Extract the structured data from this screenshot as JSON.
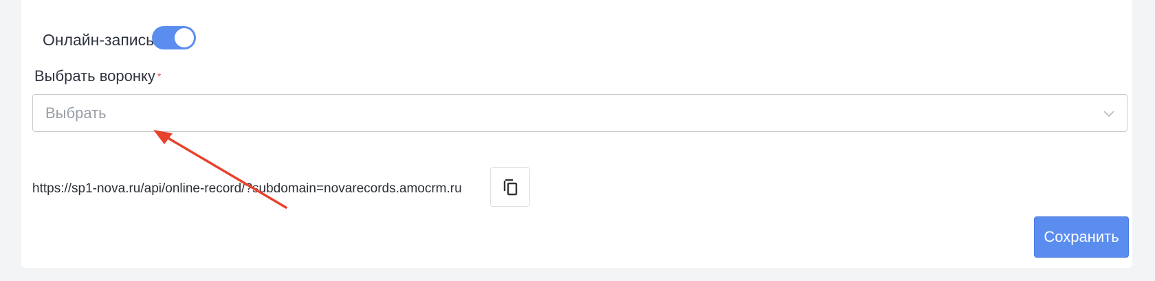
{
  "online_booking": {
    "label": "Онлайн-запись",
    "enabled": true
  },
  "funnel_field": {
    "label": "Выбрать воронку",
    "required_mark": "*",
    "placeholder": "Выбрать"
  },
  "webhook": {
    "url": "https://sp1-nova.ru/api/online-record/?subdomain=novarecords.amocrm.ru"
  },
  "actions": {
    "save_label": "Сохранить"
  },
  "icons": {
    "toggle": "toggle-switch",
    "select_chevron": "chevron-down-icon",
    "copy": "copy-icon"
  },
  "colors": {
    "accent": "#5b8def",
    "required": "#e55353",
    "annotation_arrow": "#e8412c"
  }
}
